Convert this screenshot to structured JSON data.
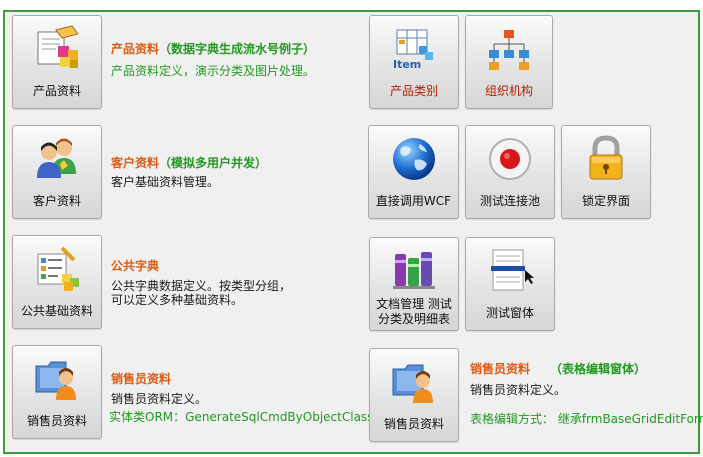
{
  "left_modules": [
    {
      "tile_label": "产品资料",
      "title": "产品资料",
      "title_note": "（数据字典生成流水号例子）",
      "desc1": "产品资料定义，演示分类及图片处理。",
      "desc2": "",
      "desc3": ""
    },
    {
      "tile_label": "客户资料",
      "title": "客户资料",
      "title_note": "（模拟多用户并发）",
      "desc1": "客户基础资料管理。",
      "desc2": "",
      "desc3": ""
    },
    {
      "tile_label": "公共基础资料",
      "title": "公共字典",
      "title_note": "",
      "desc1": "公共字典数据定义。按类型分组，",
      "desc2": "可以定义多种基础资料。",
      "desc3": ""
    },
    {
      "tile_label": "销售员资料",
      "title": "销售员资料",
      "title_note": "",
      "desc1": "销售员资料定义。",
      "desc2": "",
      "desc3": "实体类ORM：GenerateSqlCmdByObjectClass"
    }
  ],
  "right_tiles": {
    "product_category": "产品类别",
    "org_structure": "组织机构",
    "call_wcf": "直接调用WCF",
    "test_pool": "测试连接池",
    "lock_screen": "锁定界面",
    "doc_mgmt_line1": "文档管理 测试",
    "doc_mgmt_line2": "分类及明细表",
    "test_form": "测试窗体",
    "salesperson": "销售员资料"
  },
  "grid_module": {
    "title": "销售员资料",
    "title_note": "（表格编辑窗体）",
    "desc1": "销售员资料定义。",
    "desc2": "表格编辑方式：  继承frmBaseGridEditForm"
  },
  "colors": {
    "frame_border": "#3d9a3d",
    "title_orange": "#e05a12",
    "note_green": "#229922",
    "red_label": "#b32000"
  },
  "icons": {
    "product": "product-box-icon",
    "customer": "customer-people-icon",
    "dictionary": "dictionary-list-icon",
    "salesperson": "salesperson-folder-icon",
    "category": "item-category-icon",
    "org": "org-chart-icon",
    "wcf": "globe-icon",
    "pool": "record-icon",
    "lock": "padlock-icon",
    "docs": "books-icon",
    "form": "form-window-icon"
  }
}
